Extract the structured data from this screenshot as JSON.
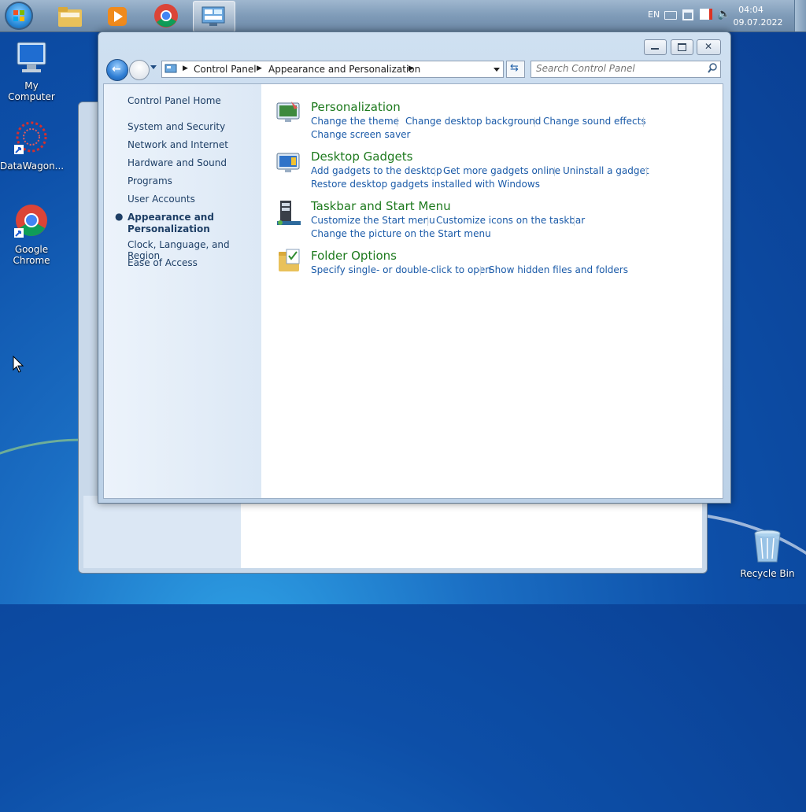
{
  "desktop": {
    "icons": [
      {
        "label": "My Computer"
      },
      {
        "label": "DataWagon..."
      },
      {
        "label": "Google Chrome"
      },
      {
        "label": "Recycle Bin"
      }
    ]
  },
  "taskbar": {
    "language": "EN",
    "time": "04:04",
    "date": "09.07.2022"
  },
  "window": {
    "breadcrumb": [
      "Control Panel",
      "Appearance and Personalization"
    ],
    "search_placeholder": "Search Control Panel",
    "sidebar": {
      "home": "Control Panel Home",
      "items": [
        "System and Security",
        "Network and Internet",
        "Hardware and Sound",
        "Programs",
        "User Accounts",
        "Appearance and Personalization",
        "Clock, Language, and Region",
        "Ease of Access"
      ],
      "current_line1": "Appearance and",
      "current_line2": "Personalization"
    },
    "categories": [
      {
        "title": "Personalization",
        "row1": [
          "Change the theme",
          "Change desktop background",
          "Change sound effects"
        ],
        "row2": [
          "Change screen saver"
        ]
      },
      {
        "title": "Desktop Gadgets",
        "row1": [
          "Add gadgets to the desktop",
          "Get more gadgets online",
          "Uninstall a gadget"
        ],
        "row2": [
          "Restore desktop gadgets installed with Windows"
        ]
      },
      {
        "title": "Taskbar and Start Menu",
        "row1": [
          "Customize the Start menu",
          "Customize icons on the taskbar"
        ],
        "row2": [
          "Change the picture on the Start menu"
        ]
      },
      {
        "title": "Folder Options",
        "row1": [
          "Specify single- or double-click to open",
          "Show hidden files and folders"
        ],
        "row2": []
      }
    ]
  },
  "colors": {
    "link": "#1a5aa8",
    "category_title": "#1e7a1e",
    "sidebar_text": "#1e3f66"
  }
}
